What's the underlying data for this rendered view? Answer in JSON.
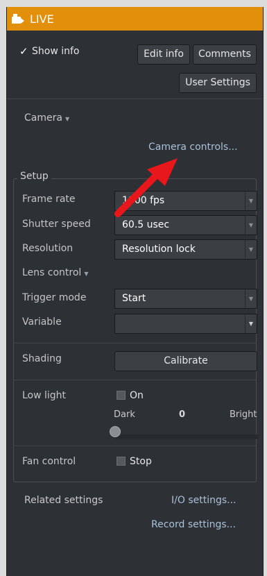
{
  "titlebar": {
    "title": "LIVE",
    "icon": "camera-icon",
    "color": "#e28f0c"
  },
  "header": {
    "show_info_label": "Show info",
    "show_info_checked": true,
    "edit_info_label": "Edit info",
    "comments_label": "Comments",
    "user_settings_label": "User Settings"
  },
  "camera": {
    "label": "Camera",
    "controls_link": "Camera controls..."
  },
  "setup": {
    "group_label": "Setup",
    "frame_rate": {
      "label": "Frame rate",
      "value": "1000 fps"
    },
    "shutter_speed": {
      "label": "Shutter speed",
      "value": "60.5 usec"
    },
    "resolution": {
      "label": "Resolution",
      "value": "Resolution lock"
    },
    "lens_control_label": "Lens control",
    "trigger_mode": {
      "label": "Trigger mode",
      "value": "Start"
    },
    "variable": {
      "label": "Variable",
      "value": ""
    },
    "shading": {
      "label": "Shading",
      "button": "Calibrate"
    },
    "low_light": {
      "label": "Low light",
      "checkbox_label": "On",
      "checked": false,
      "dark_label": "Dark",
      "bright_label": "Bright",
      "value": "0"
    },
    "fan_control": {
      "label": "Fan control",
      "checkbox_label": "Stop",
      "checked": false
    }
  },
  "related": {
    "label": "Related settings",
    "io_link": "I/O settings...",
    "record_link": "Record settings..."
  },
  "annotation": {
    "arrow_color": "#e8171b"
  }
}
